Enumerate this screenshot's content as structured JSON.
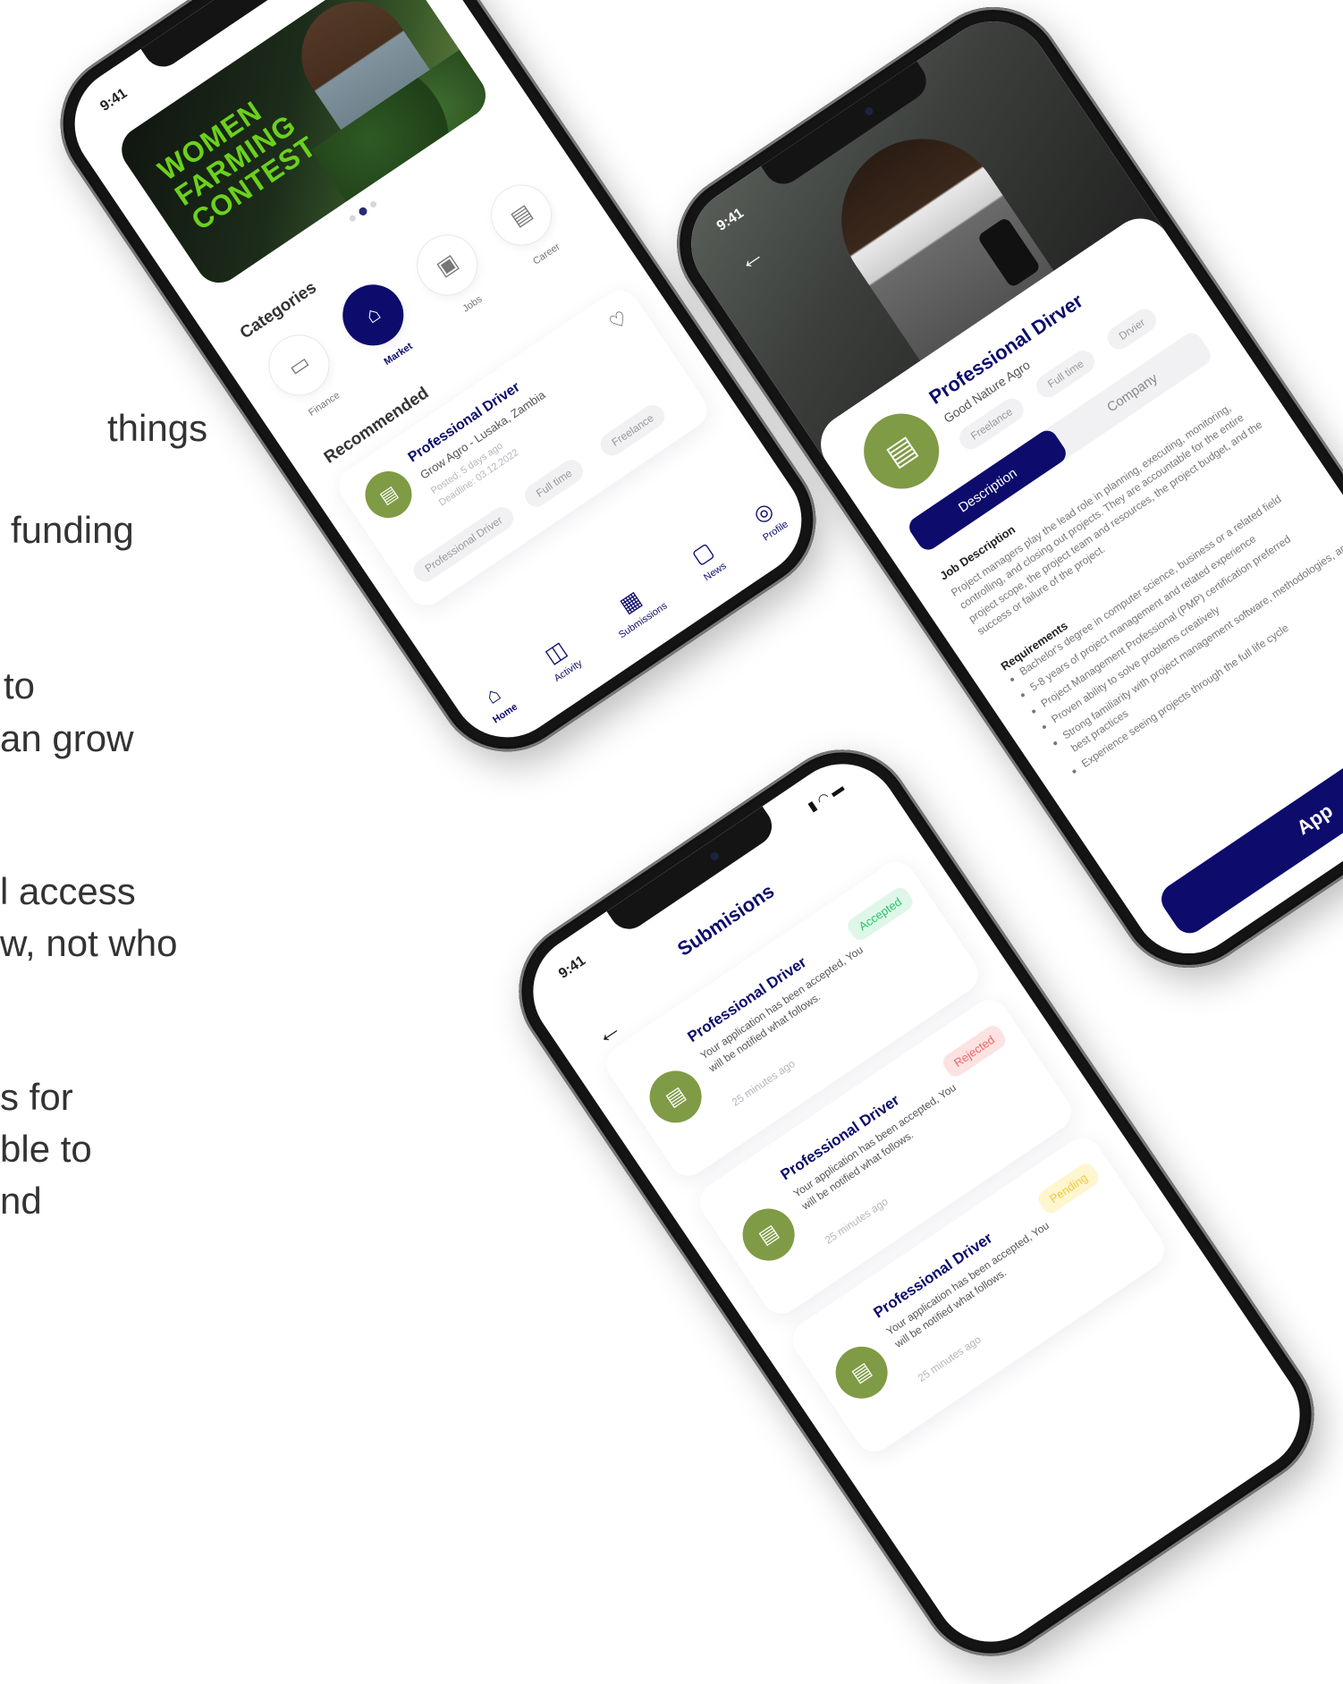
{
  "left_text": {
    "line1": "things",
    "line2": "funding",
    "line3": "to",
    "line4": "an grow",
    "line5": "l access",
    "line6": "w, not who",
    "line7": "s for",
    "line8": "ble to",
    "line9": "nd"
  },
  "colors": {
    "brand": "#0d0c6d",
    "lime": "#6bd11c",
    "olive": "#7f9b45",
    "accepted_bg": "#dff7e8",
    "accepted_text": "#29c26b",
    "rejected_bg": "#fde2e2",
    "rejected_text": "#f06565",
    "pending_bg": "#fff5cf",
    "pending_text": "#f2c93a"
  },
  "home": {
    "time": "9:41",
    "hero_title_1": "WOMEN",
    "hero_title_2": "FARMING",
    "hero_title_3": "CONTEST",
    "categories_title": "Categories",
    "categories": [
      {
        "label": "Finance",
        "icon": "banknote-icon"
      },
      {
        "label": "Market",
        "icon": "storefront-icon"
      },
      {
        "label": "Jobs",
        "icon": "briefcase-icon"
      },
      {
        "label": "Career",
        "icon": "document-icon"
      }
    ],
    "recommended_title": "Recommended",
    "card": {
      "title": "Professional Driver",
      "subtitle": "Grow Agro - Lusaka, Zambia",
      "posted": "Posted: 5 days ago",
      "deadline": "Deadline: 03.12.2022",
      "chips": [
        "Professional Driver",
        "Full time",
        "Freelance"
      ]
    },
    "nav": [
      "Home",
      "Activity",
      "Submissions",
      "News",
      "Profile"
    ]
  },
  "detail": {
    "time": "9:41",
    "title": "Professional Dirver",
    "company": "Good Nature Agro",
    "chips": [
      "Freelance",
      "Full time",
      "Drvier"
    ],
    "tabs": [
      "Description",
      "Company"
    ],
    "job_description_label": "Job Description",
    "job_description": "Project managers play the lead role in planning, executing, monitoring, controlling, and closing out projects. They are accountable for the entire project scope, the project team and resources, the project budget, and the success or failure of the project.",
    "requirements_label": "Requirements",
    "requirements": [
      "Bachelor's degree in computer science, business or a related field",
      "5-8 years of project management and related experience",
      "Project Management Professional (PMP) certification preferred",
      "Proven ability to solve problems creatively",
      "Strong familiarity with project management software, methodologies, and best practices",
      "Experience seeing projects through the full life cycle"
    ],
    "apply": "App"
  },
  "submissions": {
    "time": "9:41",
    "title": "Submisions",
    "items": [
      {
        "title": "Professional Driver",
        "message": "Your application has been accepted, You will be notified what follows.",
        "time": "25 minutes ago",
        "status": "Accepted"
      },
      {
        "title": "Professional Driver",
        "message": "Your application has been accepted, You will be notified what follows.",
        "time": "25 minutes ago",
        "status": "Rejected"
      },
      {
        "title": "Professional Driver",
        "message": "Your application has been accepted, You will be notified what follows.",
        "time": "25 minutes ago",
        "status": "Pending"
      }
    ]
  }
}
